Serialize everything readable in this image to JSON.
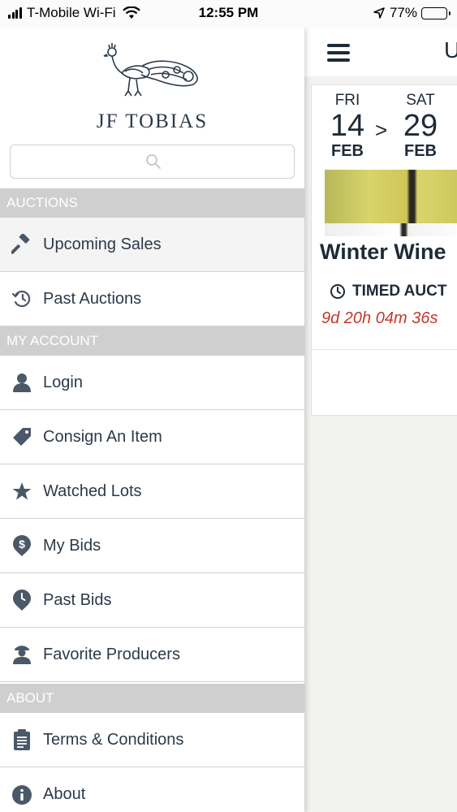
{
  "status_bar": {
    "carrier": "T-Mobile Wi-Fi",
    "time": "12:55 PM",
    "battery": "77%",
    "battery_level": 0.77
  },
  "drawer": {
    "logo_text": "JF TOBIAS",
    "search_placeholder": "",
    "sections": [
      {
        "title": "AUCTIONS",
        "items": [
          {
            "label": "Upcoming Sales",
            "icon": "gavel-icon",
            "active": true
          },
          {
            "label": "Past Auctions",
            "icon": "history-icon",
            "active": false
          }
        ]
      },
      {
        "title": "MY ACCOUNT",
        "items": [
          {
            "label": "Login",
            "icon": "user-icon"
          },
          {
            "label": "Consign An Item",
            "icon": "tag-icon"
          },
          {
            "label": "Watched Lots",
            "icon": "star-icon"
          },
          {
            "label": "My Bids",
            "icon": "dollar-pin-icon"
          },
          {
            "label": "Past Bids",
            "icon": "clock-pin-icon"
          },
          {
            "label": "Favorite Producers",
            "icon": "producer-icon"
          }
        ]
      },
      {
        "title": "ABOUT",
        "items": [
          {
            "label": "Terms & Conditions",
            "icon": "document-icon"
          },
          {
            "label": "About",
            "icon": "info-icon"
          }
        ]
      }
    ]
  },
  "main": {
    "title_peek": "U",
    "auction_card": {
      "start": {
        "dow": "FRI",
        "day": "14",
        "month": "FEB"
      },
      "end": {
        "dow": "SAT",
        "day": "29",
        "month": "FEB"
      },
      "arrow": ">",
      "title": "Winter Wine",
      "type": "TIMED AUCT",
      "countdown": "9d 20h 04m 36s"
    }
  },
  "colors": {
    "text_dark": "#2b3a4a",
    "section_bg": "#cfcfcf",
    "countdown_red": "#c0392b"
  }
}
